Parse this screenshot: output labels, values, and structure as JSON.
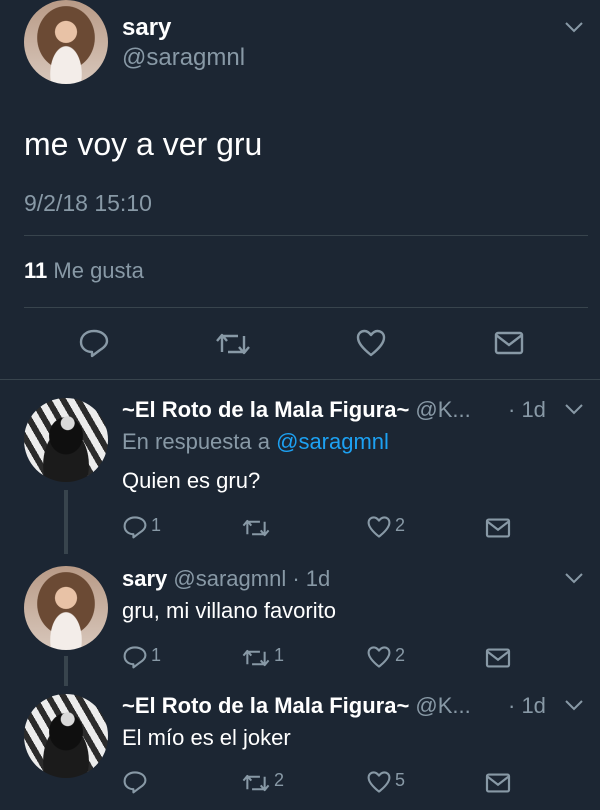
{
  "main_tweet": {
    "name": "sary",
    "handle": "@saragmnl",
    "text": "me voy a ver gru",
    "timestamp": "9/2/18 15:10",
    "likes_count": "11",
    "likes_label": "Me gusta"
  },
  "replies": [
    {
      "name": "~El Roto de la Mala Figura~",
      "handle": "@K...",
      "time": "· 1d",
      "reply_prefix": "En respuesta a",
      "reply_handle": "@saragmnl",
      "text": "Quien es gru?",
      "reply_count": "1",
      "retweet_count": "",
      "like_count": "2"
    },
    {
      "name": "sary",
      "handle": "@saragmnl",
      "time": "· 1d",
      "text": "gru, mi villano favorito",
      "reply_count": "1",
      "retweet_count": "1",
      "like_count": "2"
    },
    {
      "name": "~El Roto de la Mala Figura~",
      "handle": "@K...",
      "time": "· 1d",
      "text": "El mío es el joker",
      "reply_count": "",
      "retweet_count": "2",
      "like_count": "5"
    }
  ],
  "colors": {
    "background": "#1c2633",
    "separator": "#38444d",
    "muted": "#8899a6",
    "link": "#1da1f2",
    "text": "#ffffff"
  }
}
